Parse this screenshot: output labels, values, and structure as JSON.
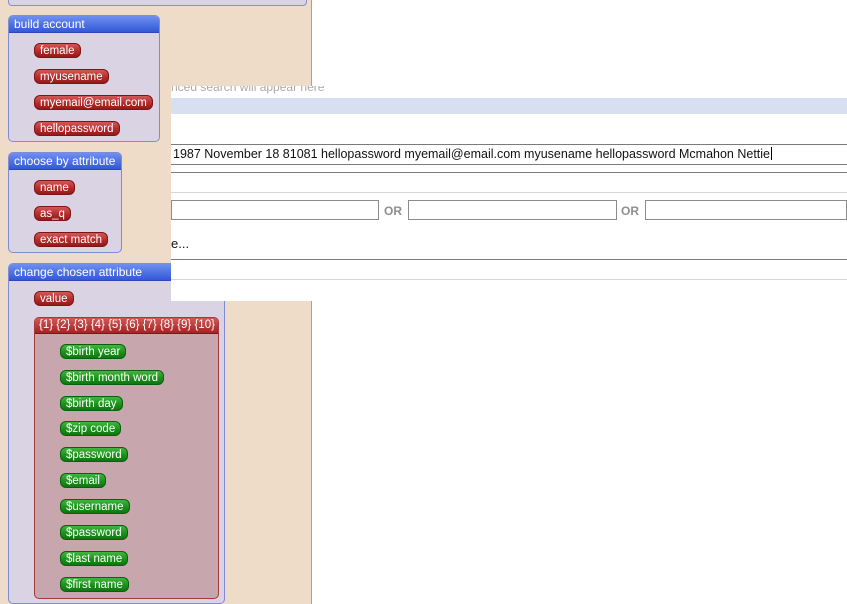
{
  "groups": {
    "build_account": {
      "title": "build account",
      "items": [
        "female",
        "myusename",
        "myemail@email.com",
        "hellopassword"
      ]
    },
    "choose_by_attribute": {
      "title": "choose by attribute",
      "items": [
        "name",
        "as_q",
        "exact match"
      ]
    },
    "change_chosen_attribute": {
      "title": "change chosen attribute",
      "value_item": "value",
      "placeholder_title": "{1} {2} {3} {4} {5} {6} {7} {8} {9} {10}",
      "variables": [
        "$birth year",
        "$birth month word",
        "$birth day",
        "$zip code",
        "$password",
        "$email",
        "$username",
        "$password",
        "$last name",
        "$first name"
      ]
    }
  },
  "overlay": {
    "hint": "nced search will appear here",
    "search_value": "1987 November 18 81081 hellopassword myemail@email.com myusename hellopassword Mcmahon Nettie",
    "or_label_1": "OR",
    "or_label_2": "OR",
    "ellipsis": "e..."
  }
}
